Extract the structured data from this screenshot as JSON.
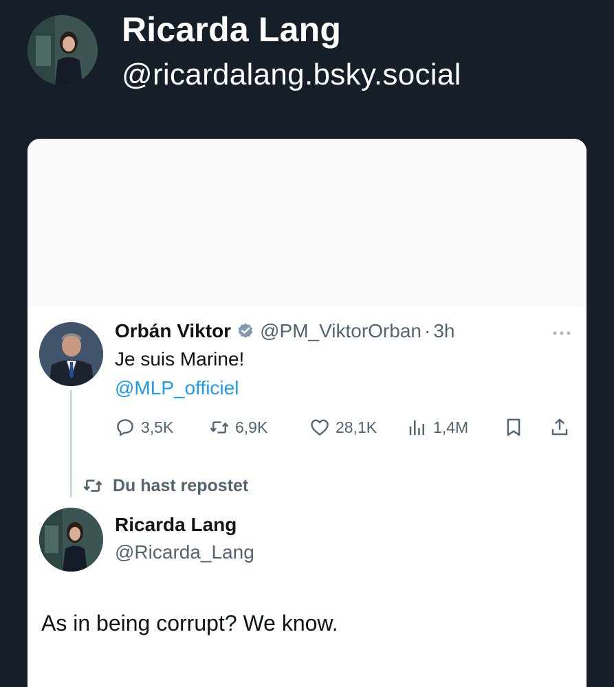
{
  "bsky": {
    "display_name": "Ricarda Lang",
    "handle": "@ricardalang.bsky.social"
  },
  "quoted_post": {
    "author_name": "Orbán Viktor",
    "author_handle": "@PM_ViktorOrban",
    "separator": "·",
    "time": "3h",
    "text": "Je suis Marine!",
    "mention": "@MLP_officiel",
    "stats": {
      "replies": "3,5K",
      "reposts": "6,9K",
      "likes": "28,1K",
      "views": "1,4M"
    }
  },
  "repost_label": "Du hast repostet",
  "reply_post": {
    "author_name": "Ricarda Lang",
    "author_handle": "@Ricarda_Lang",
    "text": "As in being corrupt? We know."
  },
  "colors": {
    "page_bg": "#161e28",
    "card_bg": "#ffffff",
    "link_blue": "#1d9bf0",
    "muted_gray": "#536471",
    "verified_gray": "#829aab"
  },
  "icons": {
    "verified": "verified-badge-icon",
    "more": "more-icon",
    "reply": "reply-icon",
    "repost": "repost-icon",
    "like": "heart-icon",
    "views": "views-icon",
    "bookmark": "bookmark-icon",
    "share": "share-icon"
  }
}
